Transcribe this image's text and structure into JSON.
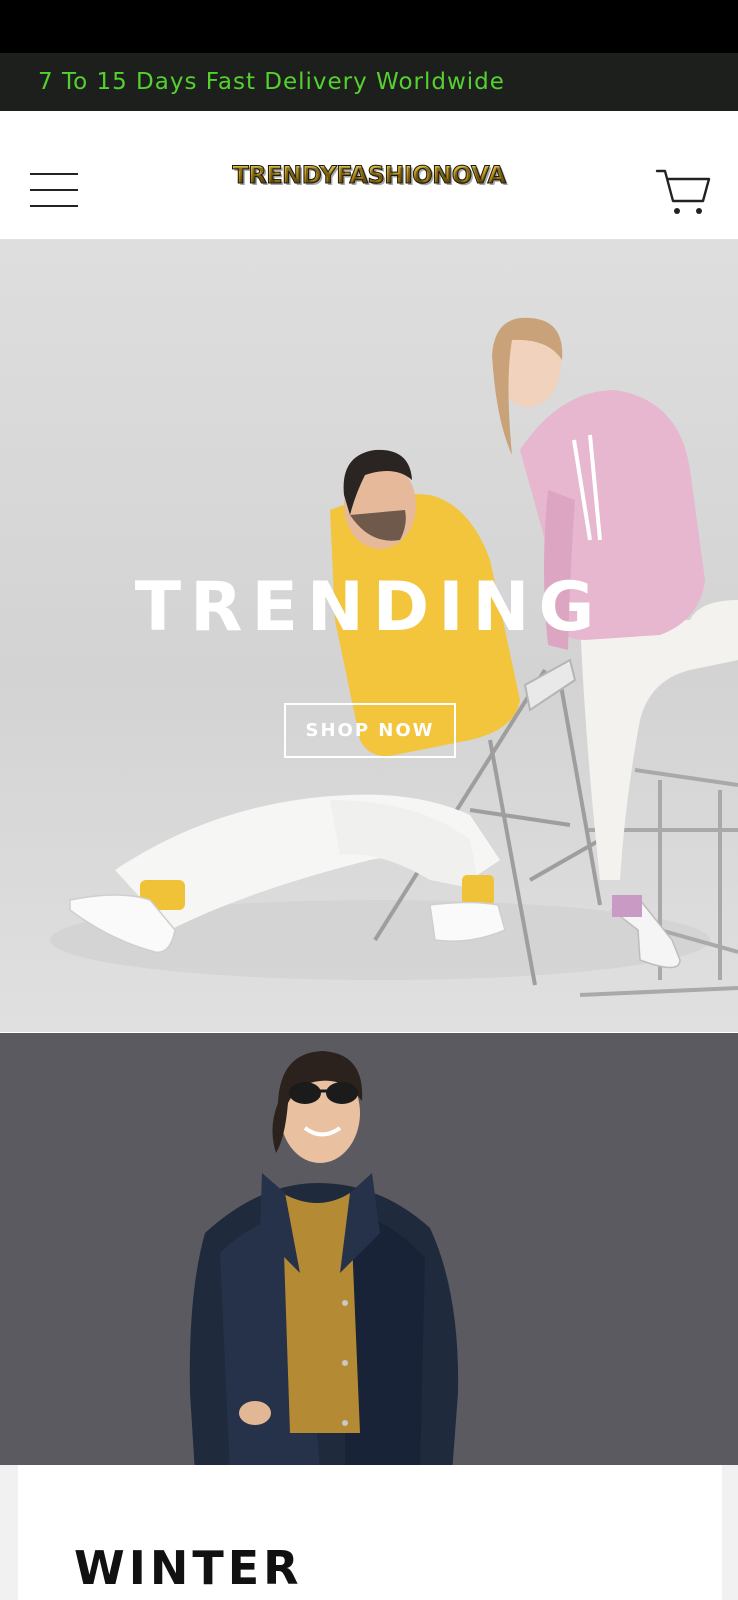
{
  "announcement": {
    "text": "7 To 15 Days Fast Delivery Worldwide",
    "color": "#55d12f"
  },
  "header": {
    "logo_text": "TRENDYFASHIONOVA",
    "menu_icon": "hamburger-menu-icon",
    "cart_icon": "shopping-cart-icon"
  },
  "hero": {
    "title": "TRENDING",
    "cta_label": "SHOP NOW"
  },
  "collection": {
    "title": "WINTER"
  }
}
